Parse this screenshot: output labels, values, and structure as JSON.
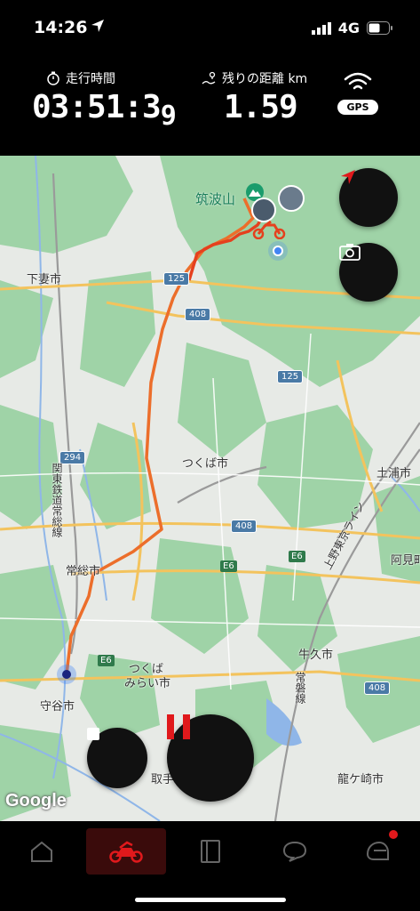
{
  "status": {
    "time": "14:26",
    "network": "4G"
  },
  "stats": {
    "elapsed_label": "走行時間",
    "elapsed_main": "03:51:3",
    "elapsed_sub": "9",
    "remaining_label": "残りの距離 km",
    "remaining_value": "1.59",
    "gps_label": "GPS"
  },
  "map": {
    "mountain": "筑波山",
    "cities": {
      "shimotsuma": "下妻市",
      "tsukuba": "つくば市",
      "tsuchiura": "土浦市",
      "joso": "常総市",
      "tsukubamirai_1": "つくば",
      "tsukubamirai_2": "みらい市",
      "moriya": "守谷市",
      "ushiku": "牛久市",
      "ami": "阿見町",
      "ryugasaki": "龍ケ崎市",
      "toride": "取手"
    },
    "roads": {
      "r125a": "125",
      "r408a": "408",
      "r125b": "125",
      "r294": "294",
      "r408b": "408",
      "r408c": "408",
      "e6a": "E6",
      "e6b": "E6",
      "e6c": "E6"
    },
    "rail_labels": {
      "kanto": "関東鉄道常総線",
      "joban": "常磐線",
      "ueno": "上野東京ライン"
    },
    "attribution": "Google"
  },
  "colors": {
    "route": "#e5401e",
    "accent": "#e0191c",
    "background": "#000000"
  },
  "tabs": [
    {
      "icon": "home-icon"
    },
    {
      "icon": "motorcycle-icon",
      "active": true
    },
    {
      "icon": "book-icon"
    },
    {
      "icon": "chat-icon"
    },
    {
      "icon": "helmet-icon",
      "badge": true
    }
  ]
}
